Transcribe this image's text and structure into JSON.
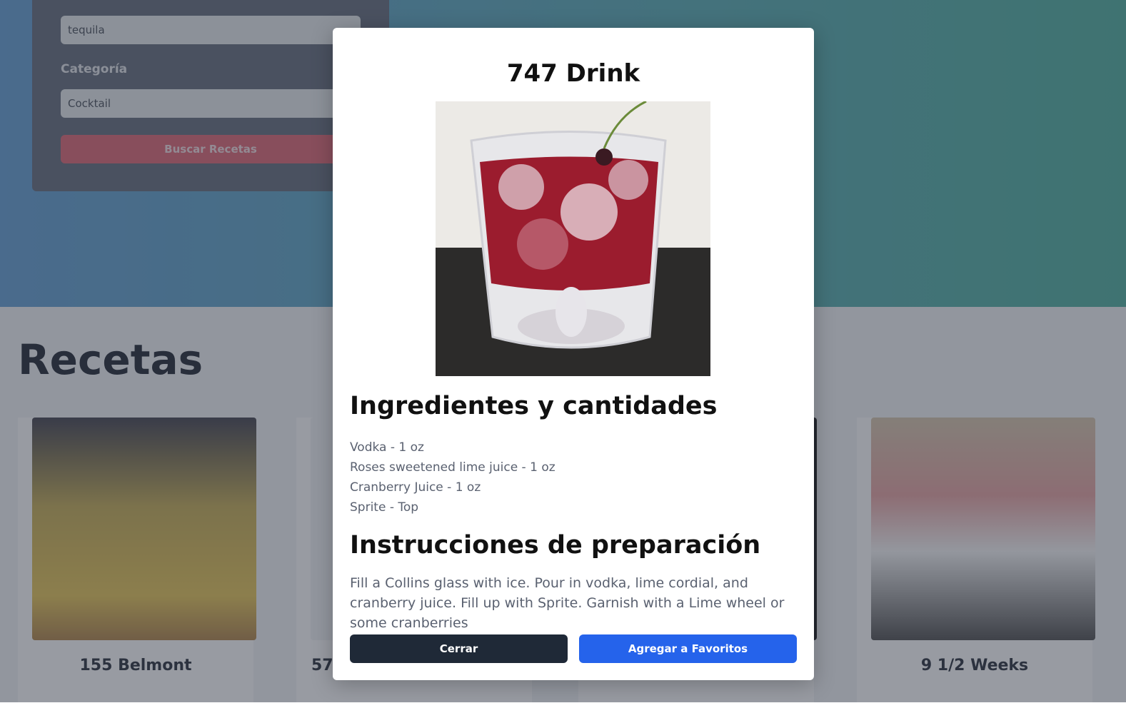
{
  "search": {
    "ingredient_value": "tequila",
    "category_label": "Categoría",
    "category_value": "Cocktail",
    "submit_label": "Buscar Recetas"
  },
  "recipes": {
    "title": "Recetas",
    "cards": [
      {
        "name": "155 Belmont"
      },
      {
        "name": "57"
      },
      {
        "name": "9 1/2 Weeks"
      }
    ]
  },
  "modal": {
    "title": "747 Drink",
    "ingredients_heading": "Ingredientes y cantidades",
    "ingredients": [
      "Vodka - 1 oz",
      "Roses sweetened lime juice - 1 oz",
      "Cranberry Juice - 1 oz",
      "Sprite - Top"
    ],
    "instructions_heading": "Instrucciones de preparación",
    "instructions": "Fill a Collins glass with ice. Pour in vodka, lime cordial, and cranberry juice. Fill up with Sprite. Garnish with a Lime wheel or some cranberries",
    "close_label": "Cerrar",
    "favorite_label": "Agregar a Favoritos"
  },
  "colors": {
    "primary_button": "#2563eb",
    "close_button": "#1f2937",
    "search_button": "#e06b79"
  }
}
